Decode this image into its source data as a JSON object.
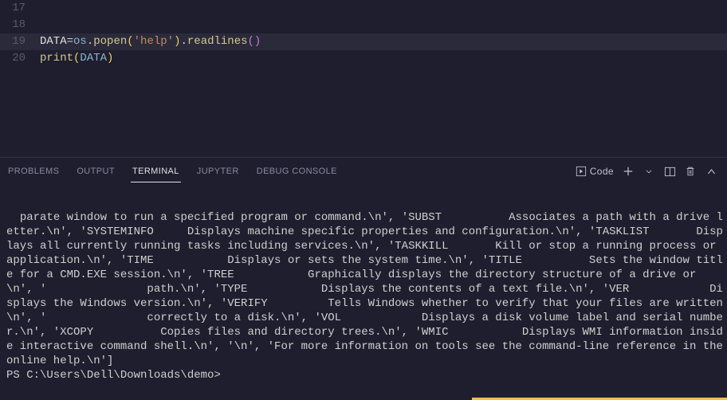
{
  "editor": {
    "lines": [
      {
        "num": "17",
        "tokens": []
      },
      {
        "num": "18",
        "tokens": []
      },
      {
        "num": "19",
        "tokens": [
          {
            "cls": "k-var",
            "t": "DATA"
          },
          {
            "cls": "k-op",
            "t": "="
          },
          {
            "cls": "k-obj",
            "t": "os"
          },
          {
            "cls": "k-dot",
            "t": "."
          },
          {
            "cls": "k-fn",
            "t": "popen"
          },
          {
            "cls": "k-paren",
            "t": "("
          },
          {
            "cls": "k-str",
            "t": "'help'"
          },
          {
            "cls": "k-paren",
            "t": ")"
          },
          {
            "cls": "k-dot",
            "t": "."
          },
          {
            "cls": "k-fn",
            "t": "readlines"
          },
          {
            "cls": "k-paren2",
            "t": "("
          },
          {
            "cls": "k-paren2",
            "t": ")"
          }
        ],
        "active": true
      },
      {
        "num": "20",
        "tokens": [
          {
            "cls": "k-call",
            "t": "print"
          },
          {
            "cls": "k-paren",
            "t": "("
          },
          {
            "cls": "k-obj",
            "t": "DATA"
          },
          {
            "cls": "k-paren",
            "t": ")"
          }
        ]
      }
    ]
  },
  "panel": {
    "tabs": [
      {
        "label": "PROBLEMS",
        "active": false
      },
      {
        "label": "OUTPUT",
        "active": false
      },
      {
        "label": "TERMINAL",
        "active": true
      },
      {
        "label": "JUPYTER",
        "active": false
      },
      {
        "label": "DEBUG CONSOLE",
        "active": false
      }
    ],
    "launchLabel": "Code"
  },
  "terminal": {
    "output": "parate window to run a specified program or command.\\n', 'SUBST          Associates a path with a drive letter.\\n', 'SYSTEMINFO     Displays machine specific properties and configuration.\\n', 'TASKLIST       Displays all currently running tasks including services.\\n', 'TASKKILL       Kill or stop a running process or application.\\n', 'TIME           Displays or sets the system time.\\n', 'TITLE          Sets the window title for a CMD.EXE session.\\n', 'TREE           Graphically displays the directory structure of a drive or \\n', '               path.\\n', 'TYPE           Displays the contents of a text file.\\n', 'VER            Displays the Windows version.\\n', 'VERIFY         Tells Windows whether to verify that your files are written\\n', '               correctly to a disk.\\n', 'VOL            Displays a disk volume label and serial number.\\n', 'XCOPY          Copies files and directory trees.\\n', 'WMIC           Displays WMI information inside interactive command shell.\\n', '\\n', 'For more information on tools see the command-line reference in the online help.\\n']",
    "prompt": "PS C:\\Users\\Dell\\Downloads\\demo>"
  }
}
